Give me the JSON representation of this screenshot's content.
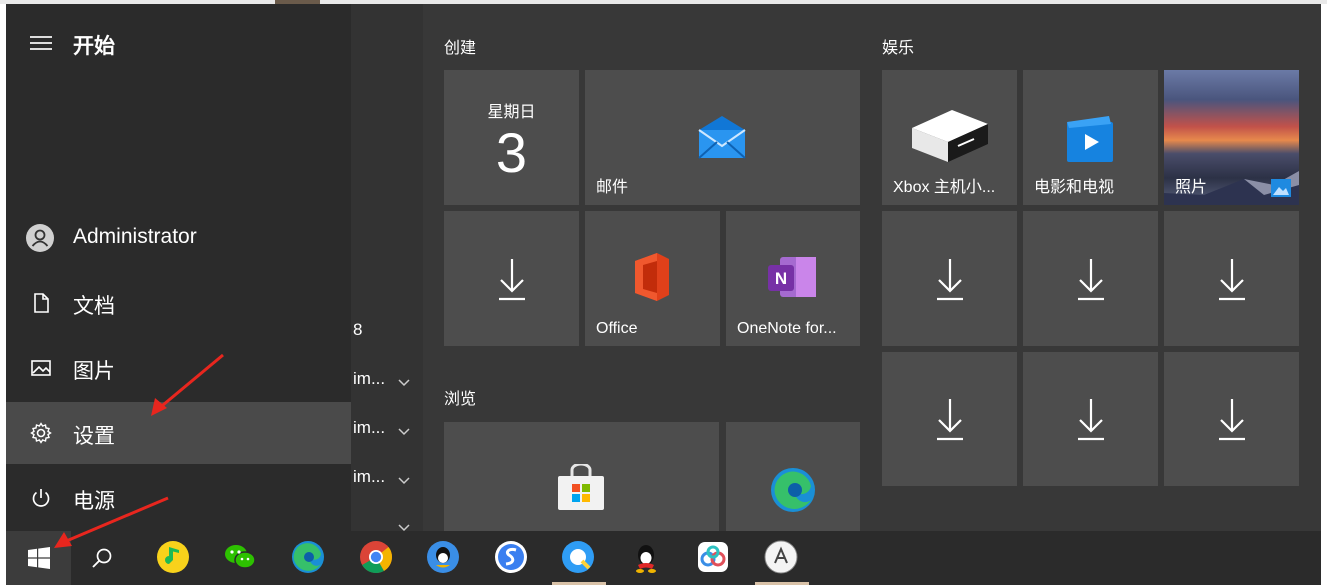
{
  "start_menu": {
    "title": "开始",
    "user": "Administrator",
    "nav": [
      {
        "label": "文档",
        "icon": "document-icon"
      },
      {
        "label": "图片",
        "icon": "pictures-icon"
      },
      {
        "label": "设置",
        "icon": "gear-icon"
      },
      {
        "label": "电源",
        "icon": "power-icon"
      }
    ],
    "app_list": {
      "fragments": [
        "8",
        "im...",
        "im...",
        "im..."
      ]
    }
  },
  "groups": {
    "create": "创建",
    "entertainment": "娱乐",
    "browse": "浏览"
  },
  "tiles": {
    "calendar_day": "星期日",
    "calendar_date": "3",
    "mail": "邮件",
    "office": "Office",
    "onenote": "OneNote for...",
    "xbox": "Xbox 主机小...",
    "movies": "电影和电视",
    "photos": "照片"
  },
  "taskbar": {
    "icons": [
      "windows-start-icon",
      "search-icon",
      "qq-music-icon",
      "wechat-icon",
      "edge-icon",
      "chrome-icon",
      "qq-avatar-icon",
      "sogou-icon",
      "qq-browser-icon",
      "qq-penguin-icon",
      "baidu-netdisk-icon",
      "circle-logo-icon"
    ]
  },
  "colors": {
    "menu_bg": "#383838",
    "rail_bg": "#2b2b2b",
    "tile_bg": "#4d4d4d",
    "active_bg": "#4a4a4a",
    "annotation_arrow": "#e8261e"
  }
}
